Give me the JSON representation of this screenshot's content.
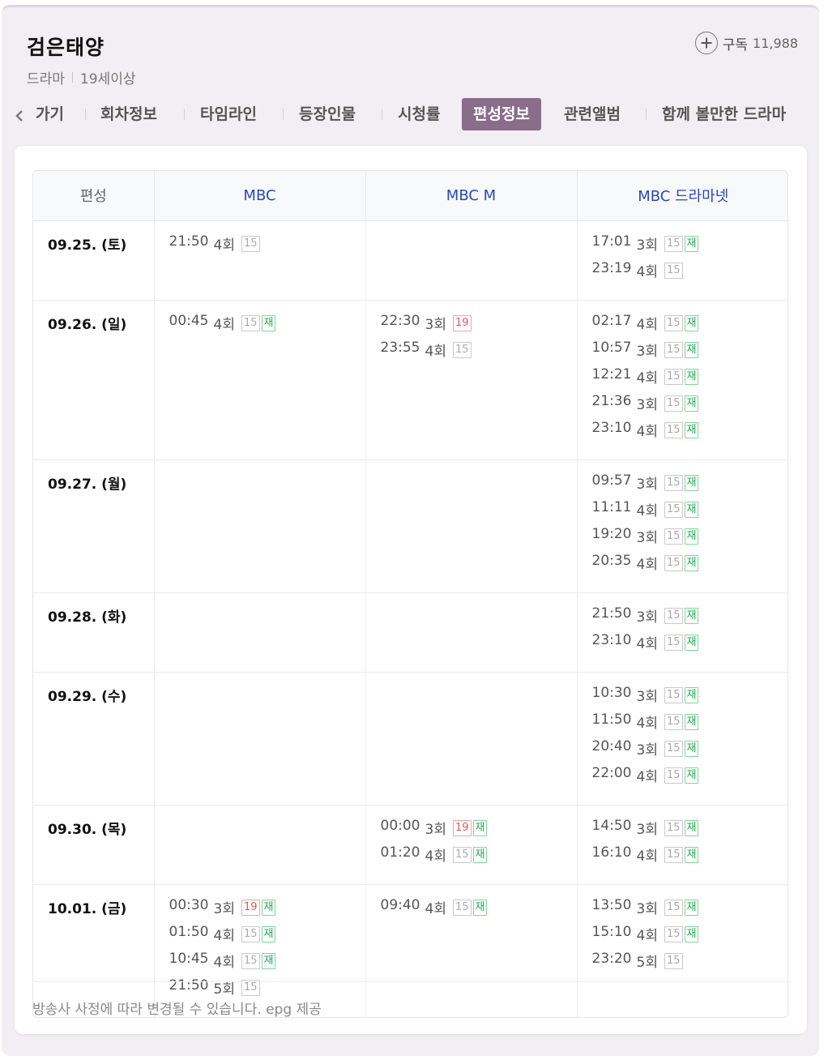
{
  "header": {
    "title": "검은태양",
    "genre": "드라마",
    "rating": "19세이상",
    "subscribe_label": "구독",
    "subscribe_count": "11,988"
  },
  "tabs": [
    {
      "label": "가기",
      "active": false
    },
    {
      "label": "회차정보",
      "active": false
    },
    {
      "label": "타임라인",
      "active": false
    },
    {
      "label": "등장인물",
      "active": false
    },
    {
      "label": "시청률",
      "active": false
    },
    {
      "label": "편성정보",
      "active": true
    },
    {
      "label": "관련앨범",
      "active": false
    },
    {
      "label": "함께 볼만한 드라마",
      "active": false
    }
  ],
  "schedule": {
    "corner_label": "편성",
    "channels": [
      "MBC",
      "MBC M",
      "MBC 드라마넷"
    ],
    "rows": [
      {
        "date": "09.25. (토)",
        "slots": [
          [
            {
              "time": "21:50",
              "ep": "4회",
              "badges": [
                "15"
              ]
            }
          ],
          [],
          [
            {
              "time": "17:01",
              "ep": "3회",
              "badges": [
                "15",
                "재"
              ]
            },
            {
              "time": "23:19",
              "ep": "4회",
              "badges": [
                "15"
              ]
            }
          ]
        ]
      },
      {
        "date": "09.26. (일)",
        "slots": [
          [
            {
              "time": "00:45",
              "ep": "4회",
              "badges": [
                "15",
                "재"
              ]
            }
          ],
          [
            {
              "time": "22:30",
              "ep": "3회",
              "badges": [
                "19"
              ]
            },
            {
              "time": "23:55",
              "ep": "4회",
              "badges": [
                "15"
              ]
            }
          ],
          [
            {
              "time": "02:17",
              "ep": "4회",
              "badges": [
                "15",
                "재"
              ]
            },
            {
              "time": "10:57",
              "ep": "3회",
              "badges": [
                "15",
                "재"
              ]
            },
            {
              "time": "12:21",
              "ep": "4회",
              "badges": [
                "15",
                "재"
              ]
            },
            {
              "time": "21:36",
              "ep": "3회",
              "badges": [
                "15",
                "재"
              ]
            },
            {
              "time": "23:10",
              "ep": "4회",
              "badges": [
                "15",
                "재"
              ]
            }
          ]
        ]
      },
      {
        "date": "09.27. (월)",
        "slots": [
          [],
          [],
          [
            {
              "time": "09:57",
              "ep": "3회",
              "badges": [
                "15",
                "재"
              ]
            },
            {
              "time": "11:11",
              "ep": "4회",
              "badges": [
                "15",
                "재"
              ]
            },
            {
              "time": "19:20",
              "ep": "3회",
              "badges": [
                "15",
                "재"
              ]
            },
            {
              "time": "20:35",
              "ep": "4회",
              "badges": [
                "15",
                "재"
              ]
            }
          ]
        ]
      },
      {
        "date": "09.28. (화)",
        "slots": [
          [],
          [],
          [
            {
              "time": "21:50",
              "ep": "3회",
              "badges": [
                "15",
                "재"
              ]
            },
            {
              "time": "23:10",
              "ep": "4회",
              "badges": [
                "15",
                "재"
              ]
            }
          ]
        ]
      },
      {
        "date": "09.29. (수)",
        "slots": [
          [],
          [],
          [
            {
              "time": "10:30",
              "ep": "3회",
              "badges": [
                "15",
                "재"
              ]
            },
            {
              "time": "11:50",
              "ep": "4회",
              "badges": [
                "15",
                "재"
              ]
            },
            {
              "time": "20:40",
              "ep": "3회",
              "badges": [
                "15",
                "재"
              ]
            },
            {
              "time": "22:00",
              "ep": "4회",
              "badges": [
                "15",
                "재"
              ]
            }
          ]
        ]
      },
      {
        "date": "09.30. (목)",
        "slots": [
          [],
          [
            {
              "time": "00:00",
              "ep": "3회",
              "badges": [
                "19",
                "재"
              ]
            },
            {
              "time": "01:20",
              "ep": "4회",
              "badges": [
                "15",
                "재"
              ]
            }
          ],
          [
            {
              "time": "14:50",
              "ep": "3회",
              "badges": [
                "15",
                "재"
              ]
            },
            {
              "time": "16:10",
              "ep": "4회",
              "badges": [
                "15",
                "재"
              ]
            }
          ]
        ]
      },
      {
        "date": "10.01. (금)",
        "slots": [
          [
            {
              "time": "00:30",
              "ep": "3회",
              "badges": [
                "19",
                "재"
              ]
            },
            {
              "time": "01:50",
              "ep": "4회",
              "badges": [
                "15",
                "재"
              ]
            },
            {
              "time": "10:45",
              "ep": "4회",
              "badges": [
                "15",
                "재"
              ]
            },
            {
              "time": "21:50",
              "ep": "5회",
              "badges": [
                "15"
              ]
            }
          ],
          [
            {
              "time": "09:40",
              "ep": "4회",
              "badges": [
                "15",
                "재"
              ]
            }
          ],
          [
            {
              "time": "13:50",
              "ep": "3회",
              "badges": [
                "15",
                "재"
              ]
            },
            {
              "time": "15:10",
              "ep": "4회",
              "badges": [
                "15",
                "재"
              ]
            },
            {
              "time": "23:20",
              "ep": "5회",
              "badges": [
                "15"
              ]
            }
          ]
        ]
      }
    ]
  },
  "footer": {
    "notice": "방송사 사정에 따라 변경될 수 있습니다. epg 제공"
  },
  "colors": {
    "active_tab": "#8a6d8a",
    "channel_header": "#2a48b8",
    "badge_19": "#e35757",
    "badge_rerun": "#1aa84b"
  }
}
